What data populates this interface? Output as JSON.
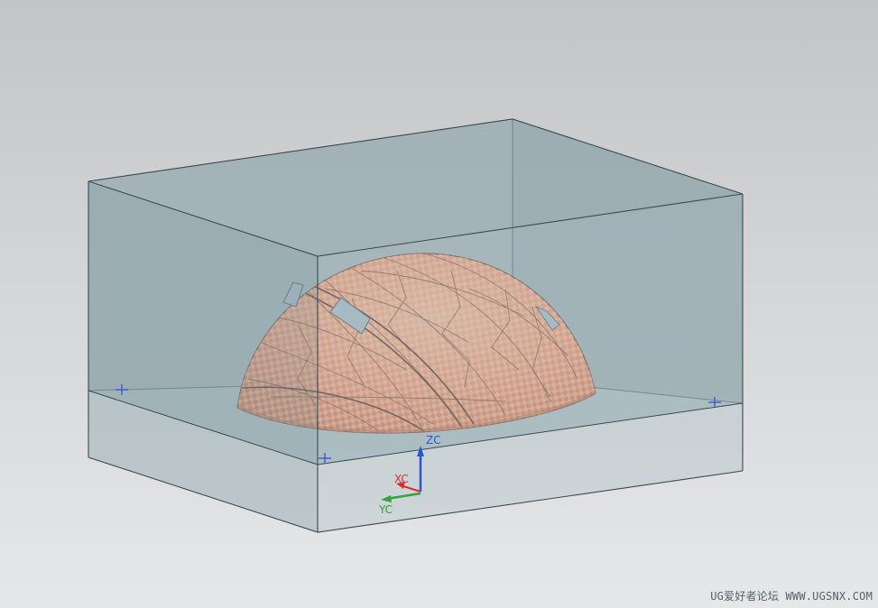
{
  "viewport": {
    "background_top": "#c2c4c6",
    "background_bottom": "#e6e7e8"
  },
  "workpiece_block": {
    "fill_color": "#9fb3b8",
    "edge_color": "#3a4a50"
  },
  "part": {
    "base_color": "#e8906a",
    "patch_color": "#f3b79a",
    "edge_color": "#6a4a3e"
  },
  "datum_markers": {
    "color": "#3a5bd0"
  },
  "wcs_triad": {
    "zc_label": "ZC",
    "xc_label": "XC",
    "yc_label": "YC",
    "zc_color": "#2a55d8",
    "xc_color": "#d83030",
    "yc_color": "#38a038"
  },
  "watermark": {
    "text": "UG爱好者论坛 WWW.UGSNX.COM"
  }
}
